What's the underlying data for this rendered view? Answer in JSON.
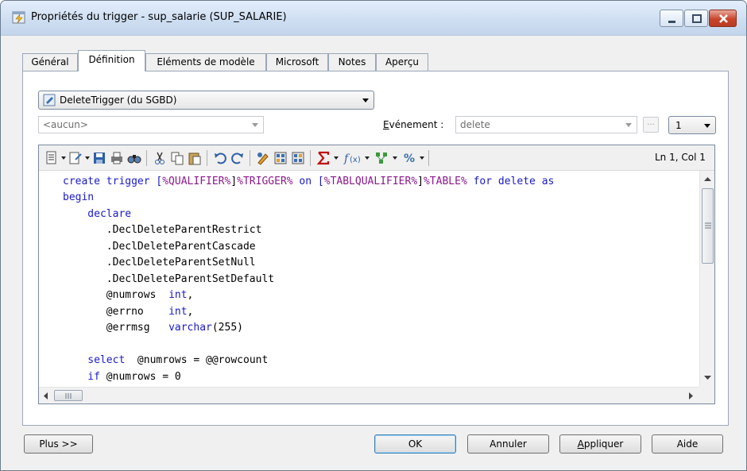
{
  "window": {
    "title": "Propriétés du trigger - sup_salarie (SUP_SALARIE)",
    "icon": "trigger-properties-icon"
  },
  "tabs": [
    {
      "label": "Général",
      "active": false
    },
    {
      "label": "Définition",
      "active": true
    },
    {
      "label": "Eléments de modèle",
      "active": false
    },
    {
      "label": "Microsoft",
      "active": false
    },
    {
      "label": "Notes",
      "active": false
    },
    {
      "label": "Aperçu",
      "active": false
    }
  ],
  "template_select": {
    "value": "DeleteTrigger (du SGBD)"
  },
  "qualifier_select": {
    "value": "<aucun>"
  },
  "event": {
    "label": "Evénement :",
    "value": "delete",
    "ellipsis": "..."
  },
  "order_select": {
    "value": "1"
  },
  "toolbar": {
    "status": "Ln 1, Col 1"
  },
  "code": {
    "lines": [
      "create trigger [%QUALIFIER%]%TRIGGER% on [%TABLQUALIFIER%]%TABLE% for delete as",
      "begin",
      "    declare",
      "       .DeclDeleteParentRestrict",
      "       .DeclDeleteParentCascade",
      "       .DeclDeleteParentSetNull",
      "       .DeclDeleteParentSetDefault",
      "       @numrows  int,",
      "       @errno    int,",
      "       @errmsg   varchar(255)",
      "",
      "    select  @numrows = @@rowcount",
      "    if @numrows = 0"
    ]
  },
  "buttons": {
    "more": "Plus >>",
    "ok": "OK",
    "cancel": "Annuler",
    "apply": "Appliquer",
    "help": "Aide"
  },
  "colors": {
    "keyword": "#1a1ac7",
    "titlebar": "#cfdff2",
    "close": "#c9462c"
  }
}
